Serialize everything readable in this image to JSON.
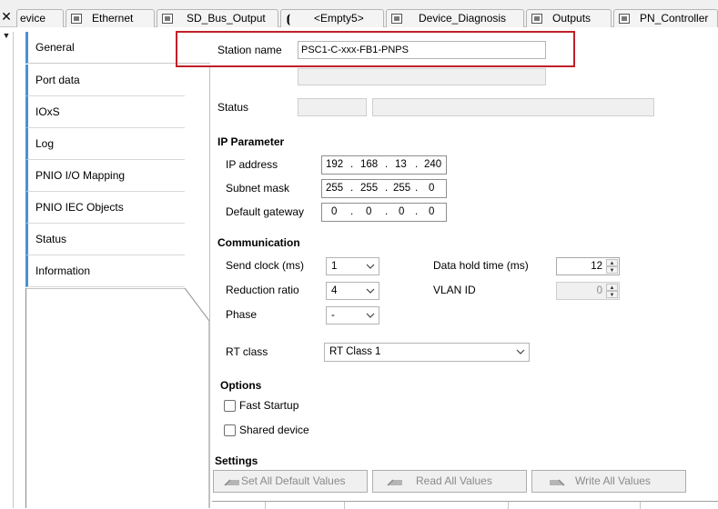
{
  "tabs": [
    {
      "label": "evice",
      "icon": "device-icon"
    },
    {
      "label": "Ethernet",
      "icon": "module-icon"
    },
    {
      "label": "SD_Bus_Output",
      "icon": "io-module-icon"
    },
    {
      "label": "<Empty5>",
      "icon": "empty-slot-icon"
    },
    {
      "label": "Device_Diagnosis",
      "icon": "io-module-icon"
    },
    {
      "label": "Outputs",
      "icon": "io-module-icon"
    },
    {
      "label": "PN_Controller",
      "icon": "module-icon"
    }
  ],
  "close_glyph": "✕",
  "nav": {
    "items": [
      "General",
      "Port data",
      "IOxS",
      "Log",
      "PNIO I/O Mapping",
      "PNIO IEC Objects",
      "Status",
      "Information"
    ],
    "active_index": 0
  },
  "general": {
    "station_name_label": "Station name",
    "station_name_value": "PSC1-C-xxx-FB1-PNPS",
    "status_label": "Status"
  },
  "ip_parameter": {
    "title": "IP Parameter",
    "ip_address_label": "IP address",
    "ip_address": [
      "192",
      "168",
      "13",
      "240"
    ],
    "subnet_mask_label": "Subnet mask",
    "subnet_mask": [
      "255",
      "255",
      "255",
      "0"
    ],
    "default_gateway_label": "Default gateway",
    "default_gateway": [
      "0",
      "0",
      "0",
      "0"
    ]
  },
  "communication": {
    "title": "Communication",
    "send_clock_label": "Send clock (ms)",
    "send_clock_value": "1",
    "reduction_ratio_label": "Reduction ratio",
    "reduction_ratio_value": "4",
    "phase_label": "Phase",
    "phase_value": "-",
    "data_hold_time_label": "Data hold time (ms)",
    "data_hold_time_value": "12",
    "vlan_id_label": "VLAN ID",
    "vlan_id_value": "0",
    "rt_class_label": "RT class",
    "rt_class_value": "RT Class 1"
  },
  "options": {
    "title": "Options",
    "fast_startup_label": "Fast Startup",
    "fast_startup_checked": false,
    "shared_device_label": "Shared device",
    "shared_device_checked": false
  },
  "settings": {
    "title": "Settings",
    "set_defaults_label": "Set All Default Values",
    "read_all_label": "Read All Values",
    "write_all_label": "Write All Values"
  },
  "colors": {
    "highlight_border": "#c0202a",
    "nav_accent": "#4a90d9",
    "disabled_text": "#8a8a8a"
  }
}
